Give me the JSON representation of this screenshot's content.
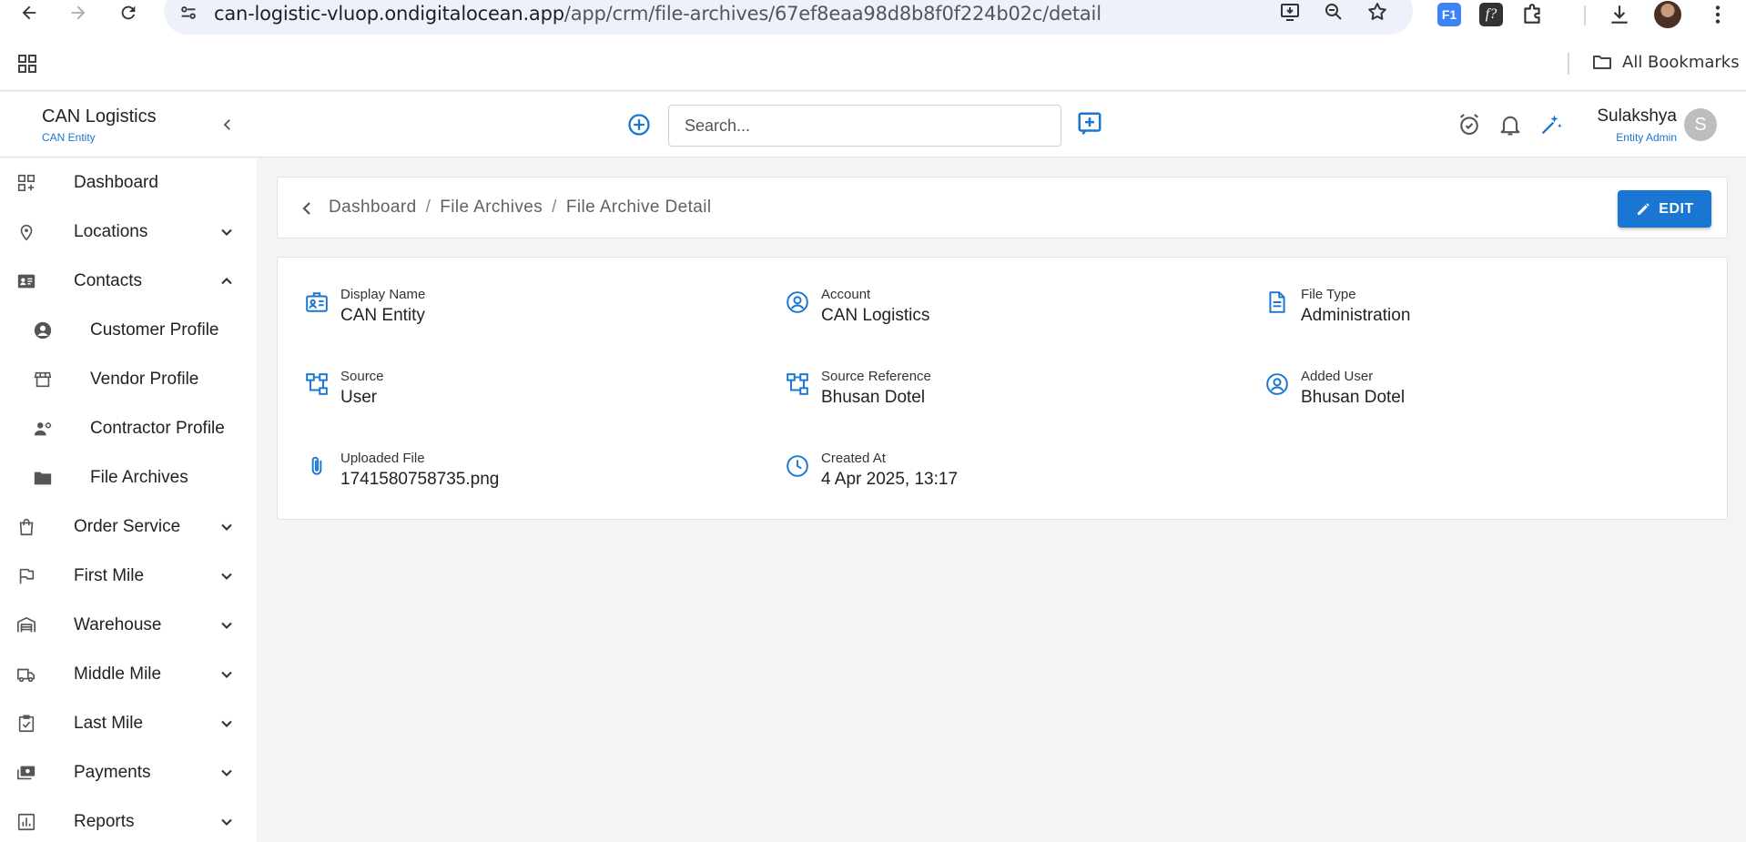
{
  "browser": {
    "url_host": "can-logistic-vluop.ondigitalocean.app",
    "url_path": "/app/crm/file-archives/67ef8eaa98d8b8f0f224b02c/detail",
    "bookmarks_label": "All Bookmarks",
    "extensions": {
      "f1": "F1",
      "fx": "f?"
    }
  },
  "header": {
    "brand_title": "CAN Logistics",
    "brand_subtitle": "CAN Entity",
    "search_placeholder": "Search...",
    "user_name": "Sulakshya",
    "user_role": "Entity Admin",
    "avatar_letter": "S"
  },
  "sidebar": {
    "items": [
      {
        "label": "Dashboard",
        "icon": "dashboard-icon"
      },
      {
        "label": "Locations",
        "icon": "location-pin-icon"
      },
      {
        "label": "Contacts",
        "icon": "contact-card-icon"
      },
      {
        "label": "Customer Profile",
        "icon": "account-circle-icon"
      },
      {
        "label": "Vendor Profile",
        "icon": "store-icon"
      },
      {
        "label": "Contractor Profile",
        "icon": "engineer-icon"
      },
      {
        "label": "File Archives",
        "icon": "folder-icon"
      },
      {
        "label": "Order Service",
        "icon": "shopping-bag-icon"
      },
      {
        "label": "First Mile",
        "icon": "flag-icon"
      },
      {
        "label": "Warehouse",
        "icon": "warehouse-icon"
      },
      {
        "label": "Middle Mile",
        "icon": "truck-icon"
      },
      {
        "label": "Last Mile",
        "icon": "checklist-icon"
      },
      {
        "label": "Payments",
        "icon": "payments-icon"
      },
      {
        "label": "Reports",
        "icon": "report-icon"
      }
    ]
  },
  "breadcrumb": {
    "items": [
      "Dashboard",
      "File Archives",
      "File Archive Detail"
    ],
    "separator": "/",
    "edit_label": "EDIT"
  },
  "details": {
    "display_name": {
      "label": "Display Name",
      "value": "CAN Entity"
    },
    "account": {
      "label": "Account",
      "value": "CAN Logistics"
    },
    "file_type": {
      "label": "File Type",
      "value": "Administration"
    },
    "source": {
      "label": "Source",
      "value": "User"
    },
    "source_reference": {
      "label": "Source Reference",
      "value": "Bhusan Dotel"
    },
    "added_user": {
      "label": "Added User",
      "value": "Bhusan Dotel"
    },
    "uploaded_file": {
      "label": "Uploaded File",
      "value": "1741580758735.png"
    },
    "created_at": {
      "label": "Created At",
      "value": "4 Apr 2025, 13:17"
    }
  },
  "colors": {
    "accent": "#1976d2",
    "sidebar_bg": "#ffffff",
    "page_bg": "#f4f4f4"
  }
}
